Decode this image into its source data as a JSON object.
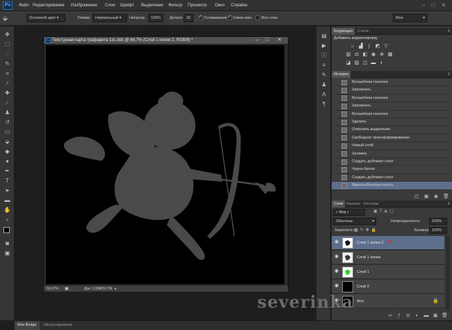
{
  "app": {
    "logo": "Ps"
  },
  "menu": [
    "Файл",
    "Редактирование",
    "Изображение",
    "Слои",
    "Шрифт",
    "Выделение",
    "Фильтр",
    "Просмотр",
    "Окно",
    "Справка"
  ],
  "options": {
    "sample_label": "Основной цвет",
    "mode_label": "Режим:",
    "mode_value": "Нормальный",
    "opacity_label": "Непрозр.:",
    "opacity_value": "100%",
    "tolerance_label": "Допуск:",
    "tolerance_value": "32",
    "antialias_label": "Сглаживание",
    "contiguous_label": "Смеж.пикс.",
    "all_layers_label": "Все слои",
    "workspace_value": "Мое"
  },
  "document": {
    "title": "Текстурная карта трафарета 1x1.dds @ 66,7% (Слой 1 копия 2, RGB/8) *",
    "zoom": "66,67%",
    "doc_size": "Док: 1,00M/10,7M"
  },
  "panels": {
    "correction_tab": "Коррекция",
    "styles_tab": "Стили",
    "add_correction": "Добавить корректировку",
    "history_tab": "История",
    "history": [
      "Волшебная палочка",
      "Запомнить",
      "Волшебная палочка",
      "Запомнить",
      "Волшебная палочка",
      "Удалить",
      "Отменить выделение",
      "Свободное трансформирование",
      "Новый слой",
      "Заливка",
      "Создать дубликат слоя",
      "Черно-белое",
      "Создать дубликат слоя",
      "Яркость/Контрастность"
    ],
    "layers_tab": "Слои",
    "channels_tab": "Каналы",
    "paths_tab": "Контуры",
    "filter_value": "Вид",
    "blend_value": "Обычные",
    "opacity_label": "Непрозрачность:",
    "opacity_value": "100%",
    "lock_label": "Закрепить:",
    "fill_label": "Заливка:",
    "fill_value": "100%",
    "layers": [
      "Слой 1 копия 2",
      "Слой 1 копия",
      "Слой 1",
      "Слой 2",
      "Фон"
    ]
  },
  "bottom": {
    "minibridge": "Mini Bridge",
    "timeline": "Шкала времени"
  },
  "watermark": "severinka"
}
